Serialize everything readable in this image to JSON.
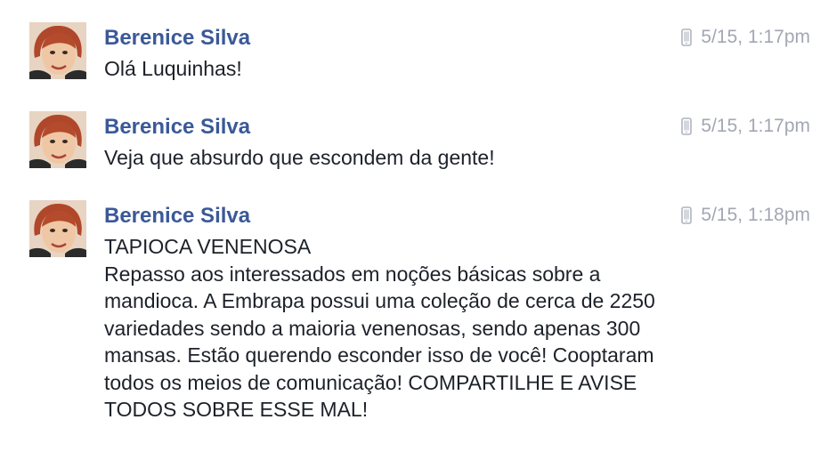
{
  "messages": [
    {
      "sender": "Berenice Silva",
      "device_icon": "mobile-phone-icon",
      "timestamp": "5/15, 1:17pm",
      "lines": [
        "Olá Luquinhas!"
      ]
    },
    {
      "sender": "Berenice Silva",
      "device_icon": "mobile-phone-icon",
      "timestamp": "5/15, 1:17pm",
      "lines": [
        "Veja que absurdo que escondem da gente!"
      ]
    },
    {
      "sender": "Berenice Silva",
      "device_icon": "mobile-phone-icon",
      "timestamp": "5/15, 1:18pm",
      "lines": [
        "TAPIOCA VENENOSA",
        "Repasso aos interessados em noções básicas sobre a",
        "mandioca. A Embrapa possui uma coleção de cerca de 2250",
        "variedades sendo a maioria venenosas, sendo apenas 300",
        "mansas. Estão querendo esconder isso de você! Cooptaram",
        "todos os meios de comunicação! COMPARTILHE E AVISE",
        "TODOS SOBRE ESSE MAL!"
      ]
    }
  ],
  "colors": {
    "sender_name": "#3b5998",
    "timestamp": "#a3a7b3",
    "message_text": "#1d2129",
    "background": "#ffffff"
  }
}
